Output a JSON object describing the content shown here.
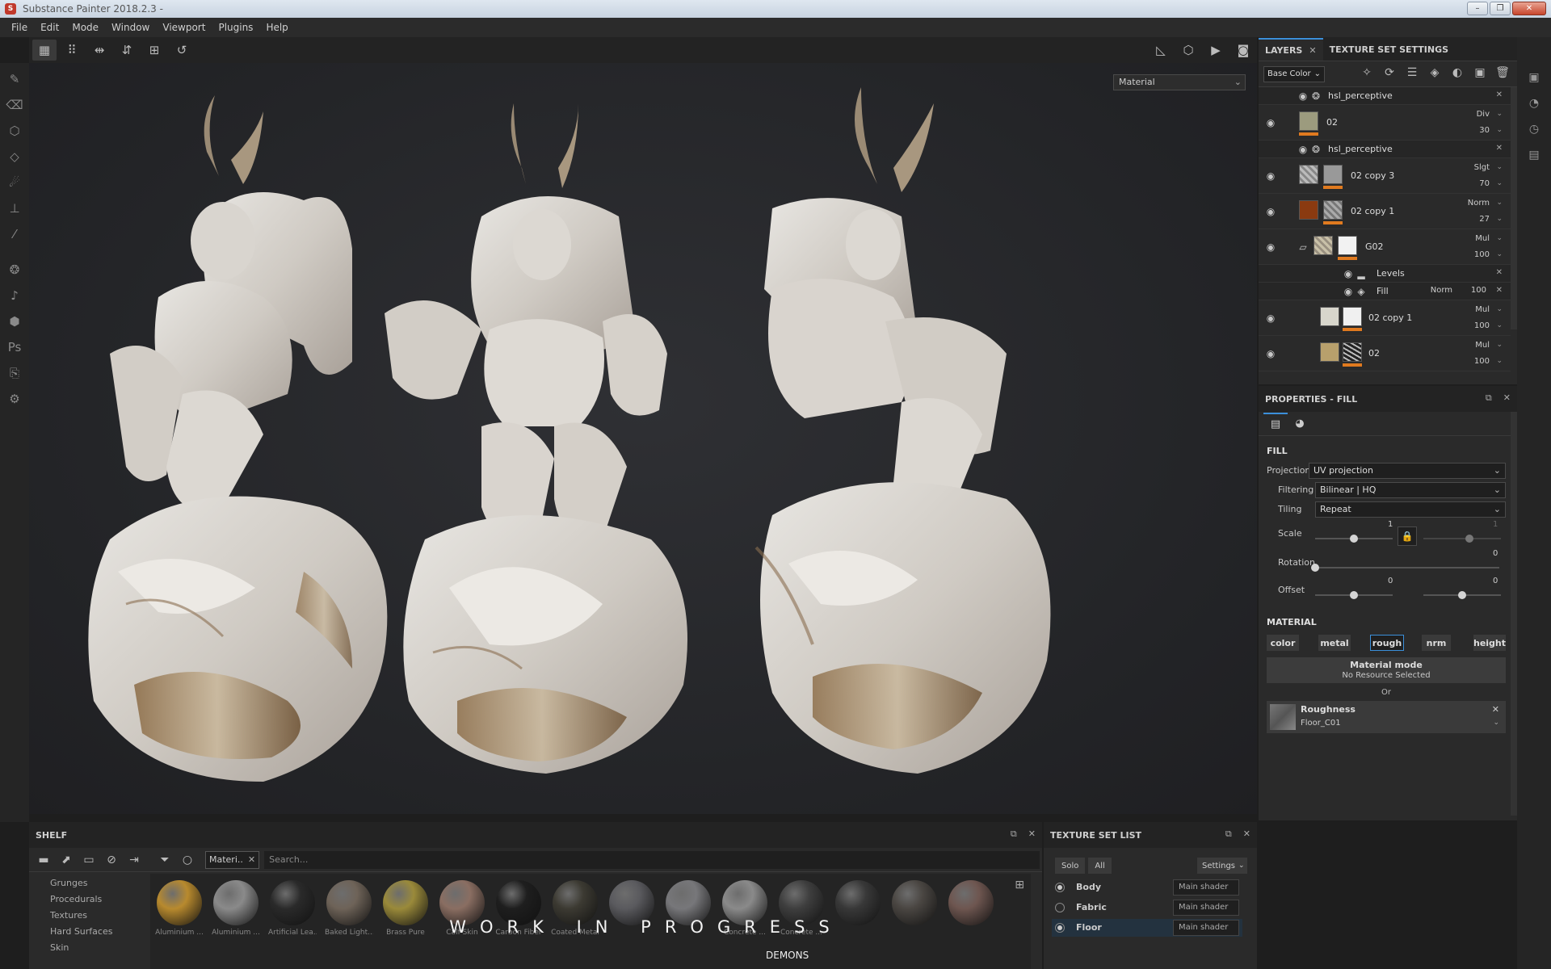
{
  "window": {
    "title": "Substance Painter 2018.2.3 -"
  },
  "menu": [
    "File",
    "Edit",
    "Mode",
    "Window",
    "Viewport",
    "Plugins",
    "Help"
  ],
  "viewport": {
    "mode_select": "Material"
  },
  "layers": {
    "tabs": {
      "layers": "LAYERS",
      "texture_set_settings": "TEXTURE SET SETTINGS"
    },
    "channel_select": "Base Color",
    "rows": [
      {
        "kind": "effect",
        "name": "hsl_perceptive"
      },
      {
        "kind": "layer",
        "name": "02",
        "blend": "Div",
        "opacity": "30"
      },
      {
        "kind": "effect",
        "name": "hsl_perceptive"
      },
      {
        "kind": "layer",
        "name": "02 copy 3",
        "blend": "Slgt",
        "opacity": "70"
      },
      {
        "kind": "layer",
        "name": "02 copy 1",
        "blend": "Norm",
        "opacity": "27"
      },
      {
        "kind": "folder",
        "name": "G02",
        "blend": "Mul",
        "opacity": "100"
      },
      {
        "kind": "effect",
        "name": "Levels"
      },
      {
        "kind": "effect",
        "name": "Fill",
        "blend": "Norm",
        "opacity": "100"
      },
      {
        "kind": "layer",
        "name": "02 copy 1",
        "blend": "Mul",
        "opacity": "100"
      },
      {
        "kind": "layer",
        "name": "02",
        "blend": "Mul",
        "opacity": "100"
      }
    ]
  },
  "properties": {
    "header": "PROPERTIES - FILL",
    "section_fill": "FILL",
    "projection": {
      "label": "Projection",
      "value": "UV projection"
    },
    "filtering": {
      "label": "Filtering",
      "value": "Bilinear | HQ"
    },
    "tiling": {
      "label": "Tiling",
      "value": "Repeat"
    },
    "scale": {
      "label": "Scale",
      "value": "1",
      "value2": "1",
      "level": 0.5
    },
    "rotation": {
      "label": "Rotation",
      "value": "0",
      "level": 0
    },
    "offset": {
      "label": "Offset",
      "value_u": "0",
      "value_v": "0",
      "level": 0.5
    },
    "section_material": "MATERIAL",
    "channels": [
      "color",
      "metal",
      "rough",
      "nrm",
      "height"
    ],
    "selected_channel": "rough",
    "material_mode": {
      "title": "Material mode",
      "subtitle": "No Resource Selected"
    },
    "or_label": "Or",
    "resource": {
      "title": "Roughness",
      "name": "Floor_C01"
    }
  },
  "shelf": {
    "title": "SHELF",
    "filter_chip": "Materi..",
    "search_placeholder": "Search...",
    "categories": [
      "Grunges",
      "Procedurals",
      "Textures",
      "Hard Surfaces",
      "Skin"
    ],
    "materials": [
      {
        "name": "Aluminium ...",
        "color": "#b88a2e"
      },
      {
        "name": "Aluminium ...",
        "color": "#8a8a8a"
      },
      {
        "name": "Artificial Lea...",
        "color": "#2a2a2a"
      },
      {
        "name": "Baked Light...",
        "color": "#6e6358"
      },
      {
        "name": "Brass Pure",
        "color": "#9a8a3a"
      },
      {
        "name": "Calf Skin",
        "color": "#8a6e62"
      },
      {
        "name": "Carbon Fiber",
        "color": "#1e1e1e"
      },
      {
        "name": "Coated Metal",
        "color": "#3c3a32"
      },
      {
        "name": "",
        "color": "#5a5a5e"
      },
      {
        "name": "",
        "color": "#77777a"
      },
      {
        "name": "Concrete ...",
        "color": "#8a8a8a"
      },
      {
        "name": "Concrete ...",
        "color": "#3e3e3e"
      },
      {
        "name": "",
        "color": "#383838"
      },
      {
        "name": "",
        "color": "#4a4642"
      },
      {
        "name": "",
        "color": "#6e5650"
      }
    ]
  },
  "texture_set_list": {
    "title": "TEXTURE SET LIST",
    "solo": "Solo",
    "all": "All",
    "settings": "Settings",
    "sets": [
      {
        "name": "Body",
        "shader": "Main shader",
        "selected": true
      },
      {
        "name": "Fabric",
        "shader": "Main shader",
        "selected": false
      },
      {
        "name": "Floor",
        "shader": "Main shader",
        "selected": true
      }
    ]
  },
  "overlay": {
    "headline": "WORK IN PROGRESS",
    "subtitle": "DEMONS"
  },
  "colors": {
    "accent": "#3b8fd9",
    "layer_mask_bar": "#e07a1f",
    "marble": "#d8d4ce"
  }
}
